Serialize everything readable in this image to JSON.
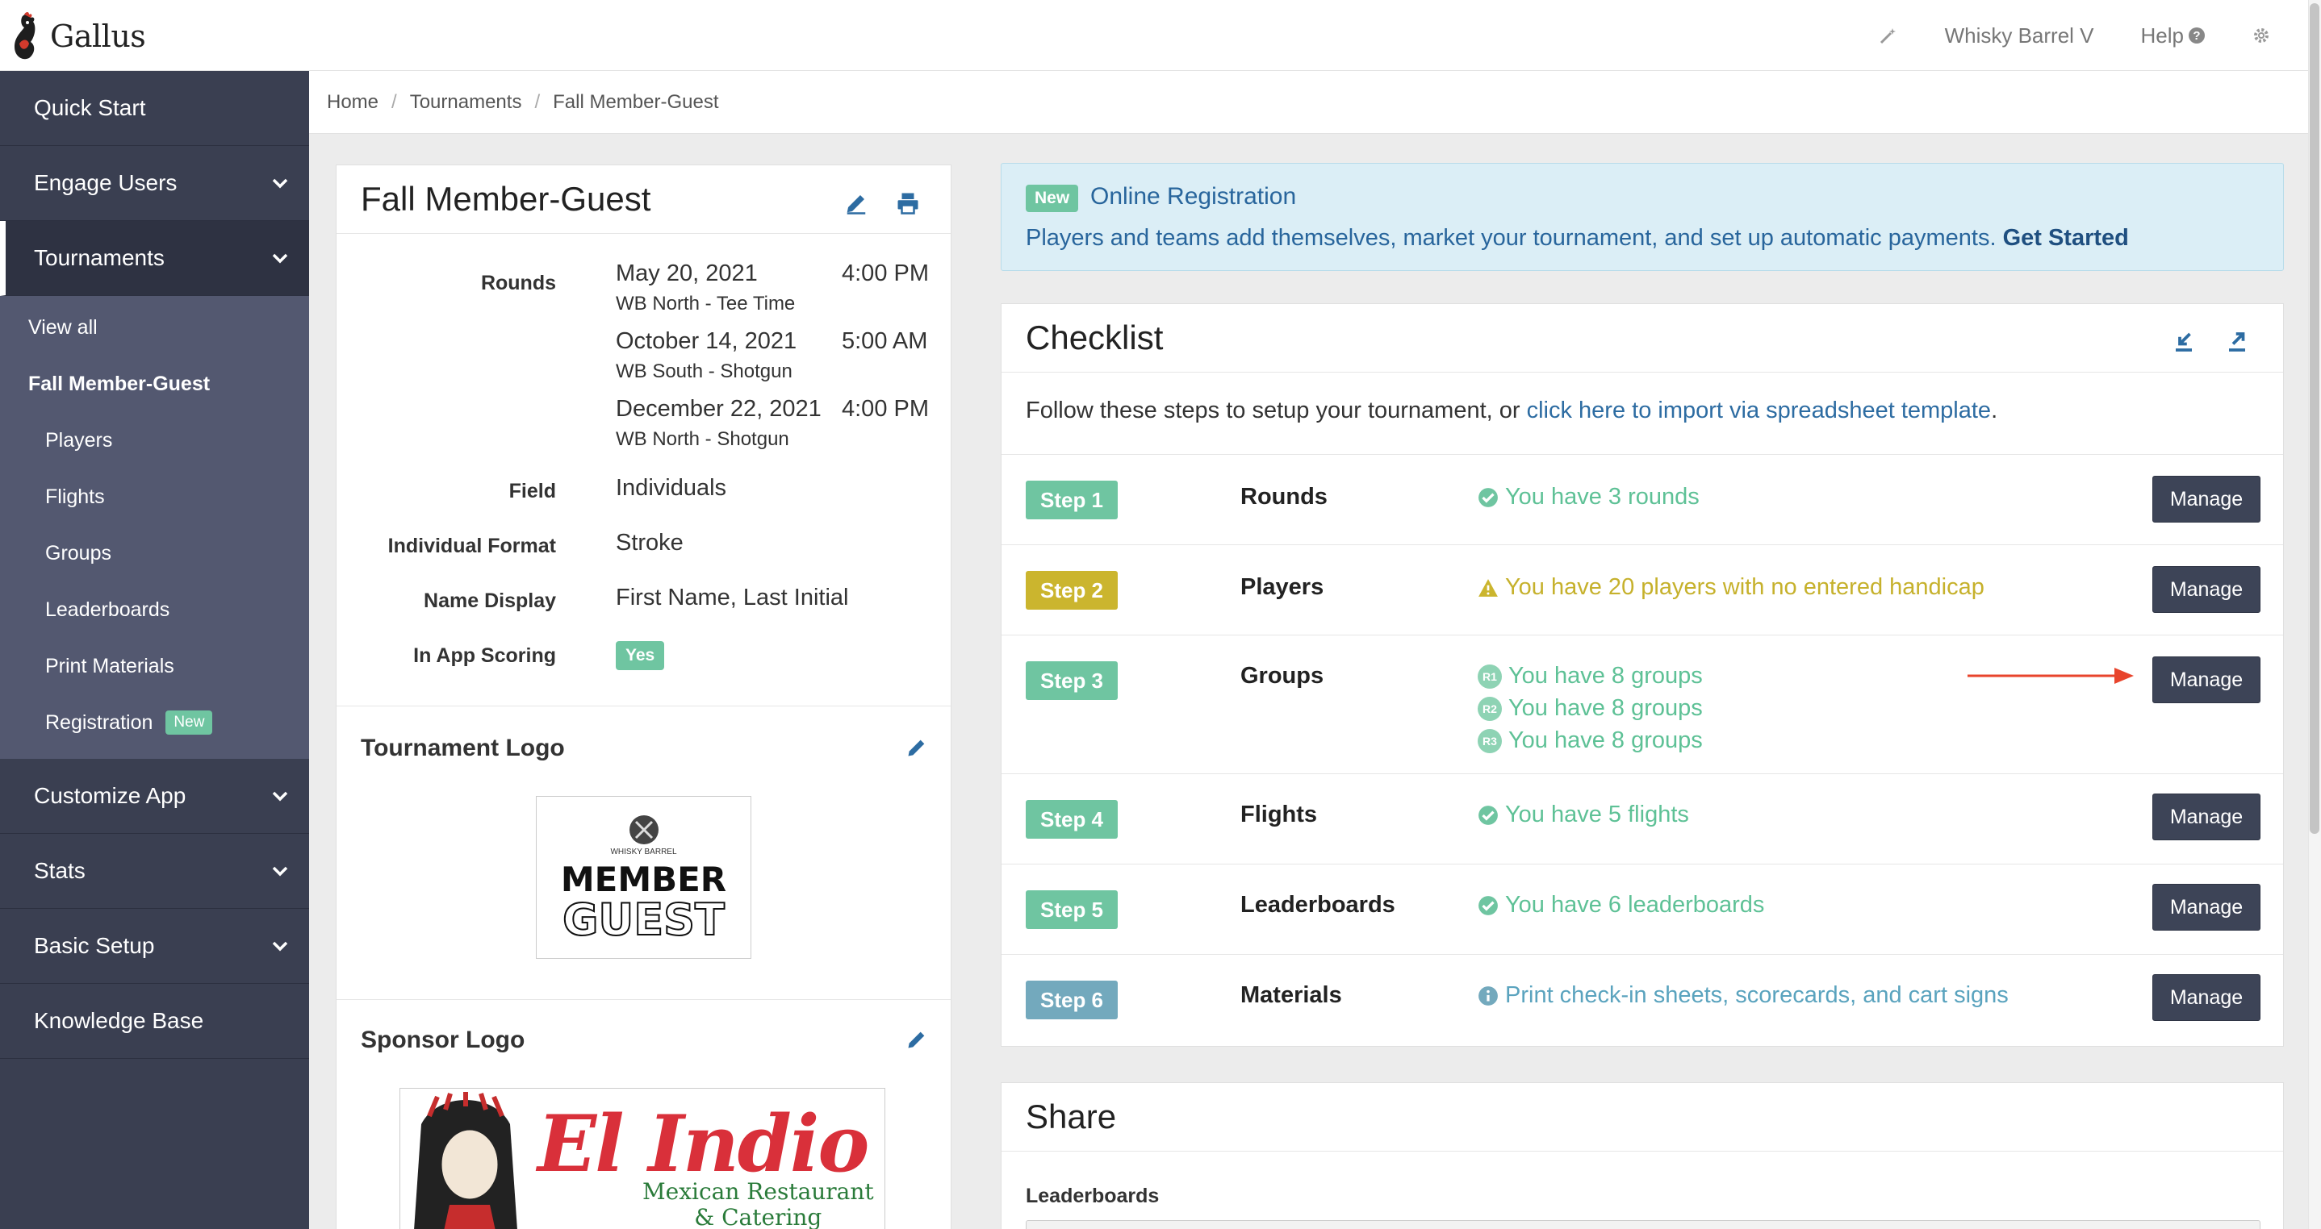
{
  "app": {
    "name": "Gallus"
  },
  "topbar": {
    "account": "Whisky Barrel V",
    "help": "Help"
  },
  "sidebar": {
    "items": [
      {
        "label": "Quick Start"
      },
      {
        "label": "Engage Users"
      },
      {
        "label": "Tournaments"
      },
      {
        "label": "Customize App"
      },
      {
        "label": "Stats"
      },
      {
        "label": "Basic Setup"
      },
      {
        "label": "Knowledge Base"
      }
    ],
    "sub": {
      "view_all": "View all",
      "current": "Fall Member-Guest",
      "items": [
        {
          "label": "Players"
        },
        {
          "label": "Flights"
        },
        {
          "label": "Groups"
        },
        {
          "label": "Leaderboards"
        },
        {
          "label": "Print Materials"
        },
        {
          "label": "Registration"
        }
      ],
      "new_badge": "New"
    }
  },
  "breadcrumb": [
    "Home",
    "Tournaments",
    "Fall Member-Guest"
  ],
  "tournament": {
    "title": "Fall Member-Guest",
    "rounds_label": "Rounds",
    "rounds": [
      {
        "date": "May 20, 2021",
        "time": "4:00 PM",
        "course": "WB North - Tee Time"
      },
      {
        "date": "October 14, 2021",
        "time": "5:00 AM",
        "course": "WB South - Shotgun"
      },
      {
        "date": "December 22, 2021",
        "time": "4:00 PM",
        "course": "WB North - Shotgun"
      }
    ],
    "field_label": "Field",
    "field": "Individuals",
    "format_label": "Individual Format",
    "format": "Stroke",
    "name_display_label": "Name Display",
    "name_display": "First Name, Last Initial",
    "in_app_label": "In App Scoring",
    "in_app": "Yes",
    "logo_title": "Tournament Logo",
    "logo_small": "WHISKY BARREL",
    "logo_line1": "MEMBER",
    "logo_line2": "GUEST",
    "sponsor_title": "Sponsor Logo",
    "sponsor_name": "El Indio",
    "sponsor_sub1": "Mexican Restaurant",
    "sponsor_sub2": "& Catering"
  },
  "registration": {
    "badge": "New",
    "title": "Online Registration",
    "text": "Players and teams add themselves, market your tournament, and set up automatic payments.",
    "cta": "Get Started"
  },
  "checklist": {
    "title": "Checklist",
    "intro": "Follow these steps to setup your tournament, or",
    "intro_link": "click here to import via spreadsheet template",
    "intro_end": ".",
    "manage": "Manage",
    "steps": [
      {
        "badge": "Step 1",
        "name": "Rounds",
        "status": "You have 3 rounds",
        "color": "#6fc5a1"
      },
      {
        "badge": "Step 2",
        "name": "Players",
        "status": "You have 20 players with no entered handicap",
        "color": "#cbb52e"
      },
      {
        "badge": "Step 3",
        "name": "Groups",
        "rounds": [
          {
            "tag": "R1",
            "status": "You have 8 groups"
          },
          {
            "tag": "R2",
            "status": "You have 8 groups"
          },
          {
            "tag": "R3",
            "status": "You have 8 groups"
          }
        ],
        "color": "#6fc5a1"
      },
      {
        "badge": "Step 4",
        "name": "Flights",
        "status": "You have 5 flights",
        "color": "#6fc5a1"
      },
      {
        "badge": "Step 5",
        "name": "Leaderboards",
        "status": "You have 6 leaderboards",
        "color": "#6fc5a1"
      },
      {
        "badge": "Step 6",
        "name": "Materials",
        "status": "Print check-in sheets, scorecards, and cart signs",
        "color": "#73a9bd"
      }
    ]
  },
  "share": {
    "title": "Share",
    "leaderboards_label": "Leaderboards"
  },
  "colors": {
    "sidebar": "#3a3f51",
    "accent_green": "#6fc5a1",
    "warning": "#cbb52e",
    "info": "#73a9bd",
    "manage_button": "#3d4457",
    "arrow": "#e8442c"
  }
}
